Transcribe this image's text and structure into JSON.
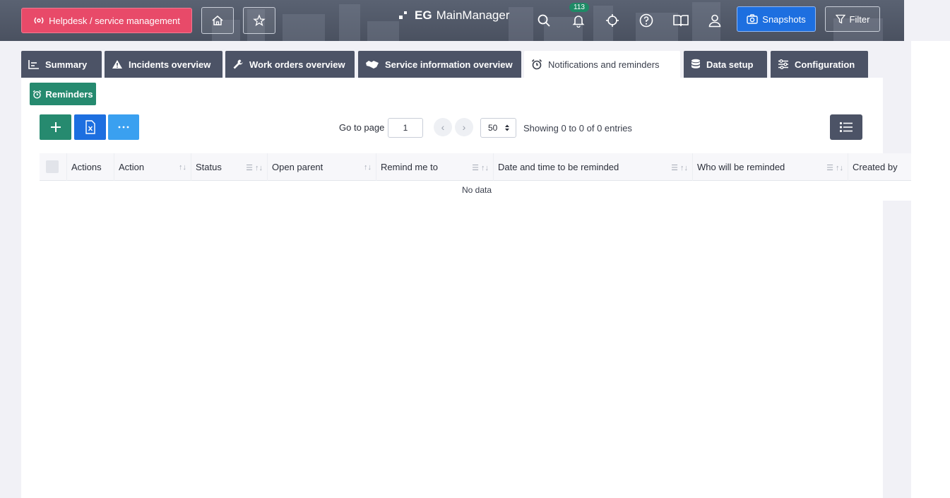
{
  "header": {
    "helpdesk_label": "Helpdesk / service management",
    "logo_prefix": "EG",
    "logo_name": "MainManager",
    "notification_count": "113",
    "snapshots_label": "Snapshots",
    "filter_label": "Filter"
  },
  "tabs": [
    {
      "label": "Summary"
    },
    {
      "label": "Incidents overview"
    },
    {
      "label": "Work orders overview"
    },
    {
      "label": "Service information overview"
    },
    {
      "label": "Notifications and reminders"
    },
    {
      "label": "Data setup"
    },
    {
      "label": "Configuration"
    }
  ],
  "subtab": {
    "label": "Reminders"
  },
  "toolbar": {
    "add_icon": "plus-icon",
    "excel_icon": "excel-icon",
    "more_icon": "ellipsis-icon",
    "goto_label": "Go to page",
    "page_value": "1",
    "per_page": "50",
    "showing": "Showing 0 to 0 of 0 entries"
  },
  "table": {
    "columns": [
      "Actions",
      "Action",
      "Status",
      "Open parent",
      "Remind me to",
      "Date and time to be reminded",
      "Who will be reminded",
      "Created by"
    ],
    "empty_text": "No data"
  },
  "colors": {
    "header_bg": "#4a5160",
    "helpdesk": "#e84a69",
    "tab_bg": "#4c5366",
    "green": "#268a6f",
    "blue": "#1d6fe0",
    "light_blue": "#3aa0f0"
  }
}
